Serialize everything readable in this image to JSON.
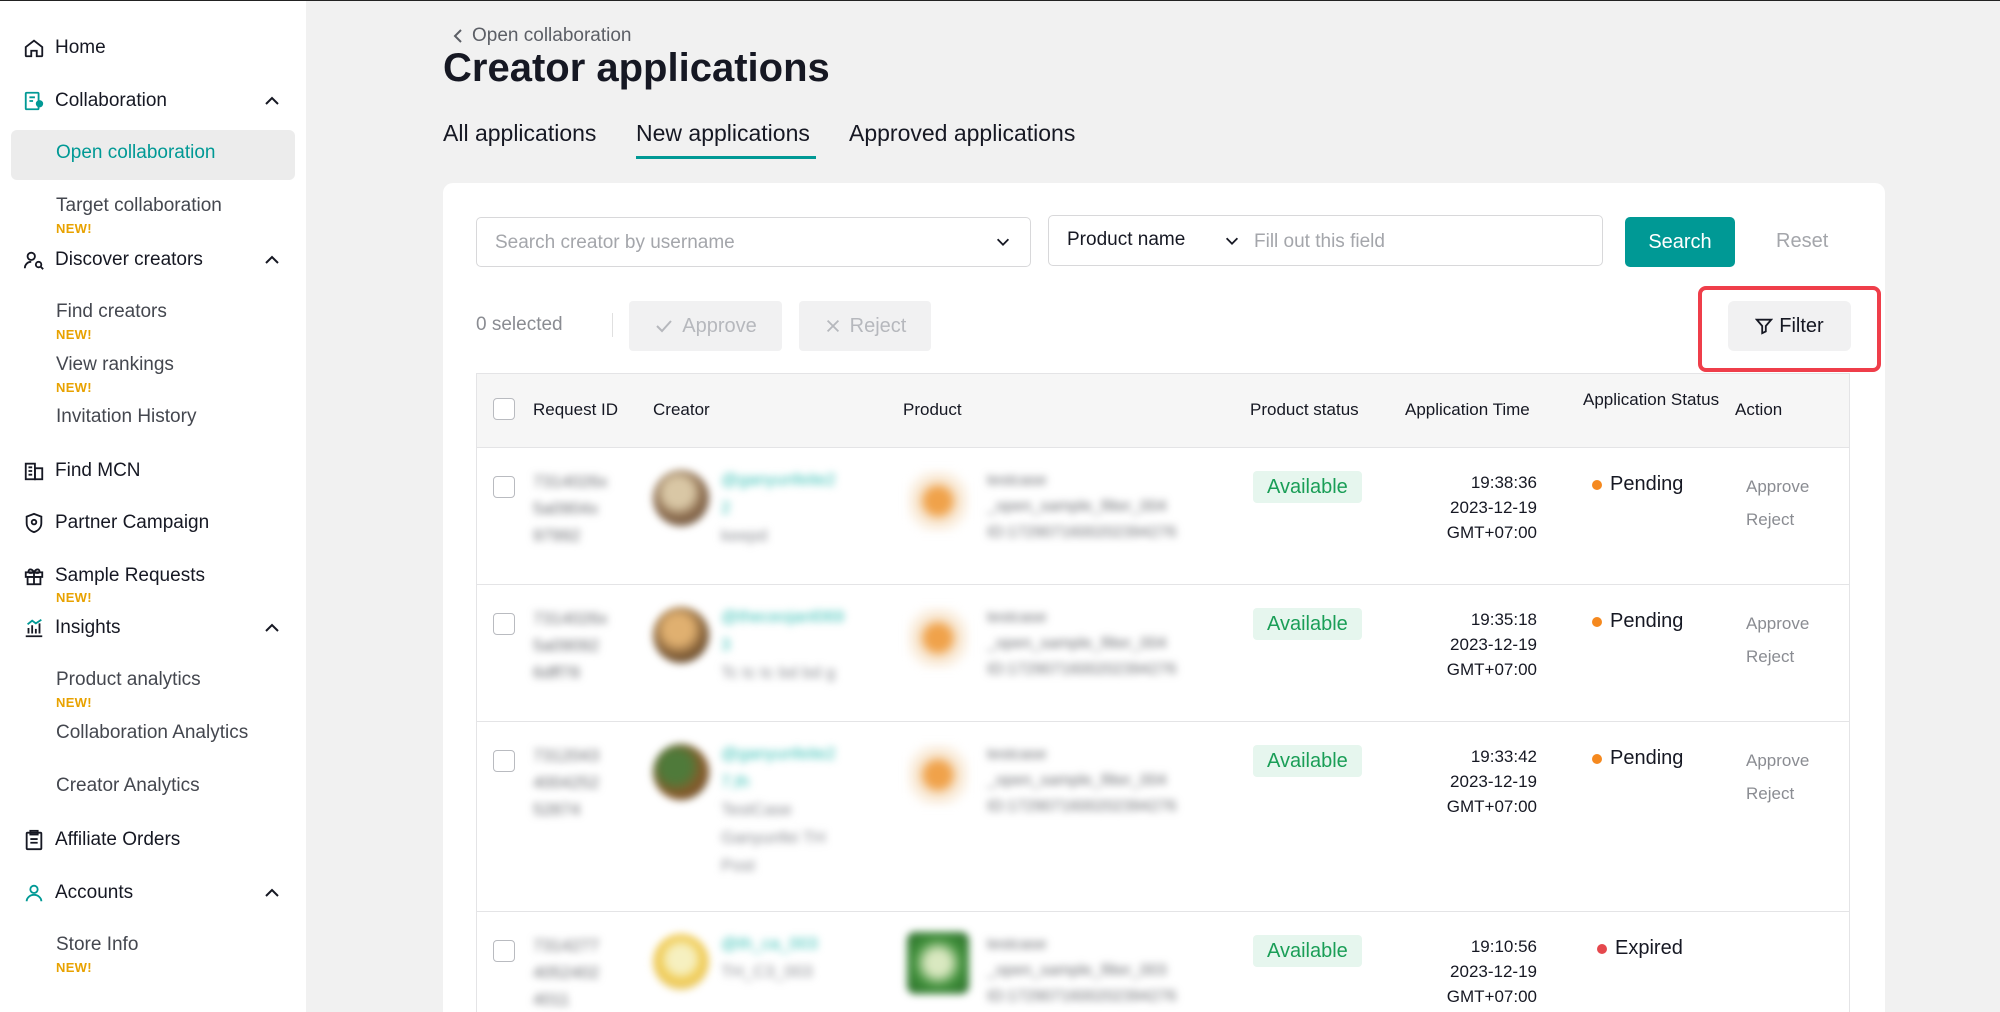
{
  "sidebar": {
    "items": [
      {
        "label": "Home",
        "icon": "home-icon"
      },
      {
        "label": "Collaboration",
        "icon": "collaboration-icon"
      },
      {
        "label": "Open collaboration"
      },
      {
        "label": "Target collaboration",
        "badge": "NEW!"
      },
      {
        "label": "Discover creators",
        "icon": "discover-creators-icon"
      },
      {
        "label": "Find creators",
        "badge": "NEW!"
      },
      {
        "label": "View rankings",
        "badge": "NEW!"
      },
      {
        "label": "Invitation History"
      },
      {
        "label": "Find MCN",
        "icon": "building-icon"
      },
      {
        "label": "Partner Campaign",
        "icon": "shield-icon"
      },
      {
        "label": "Sample Requests",
        "icon": "gift-icon",
        "badge": "NEW!"
      },
      {
        "label": "Insights",
        "icon": "bar-chart-icon"
      },
      {
        "label": "Product analytics",
        "badge": "NEW!"
      },
      {
        "label": "Collaboration Analytics"
      },
      {
        "label": "Creator Analytics"
      },
      {
        "label": "Affiliate Orders",
        "icon": "clipboard-icon"
      },
      {
        "label": "Accounts",
        "icon": "user-icon"
      },
      {
        "label": "Store Info",
        "badge": "NEW!"
      }
    ]
  },
  "header": {
    "back_label": "Open collaboration",
    "title": "Creator applications"
  },
  "tabs": [
    {
      "label": "All applications"
    },
    {
      "label": "New applications",
      "active": true
    },
    {
      "label": "Approved applications"
    }
  ],
  "search": {
    "creator_placeholder": "Search creator by username",
    "product_field_selected": "Product name",
    "product_placeholder": "Fill out this field",
    "search_label": "Search",
    "reset_label": "Reset"
  },
  "toolbar": {
    "selected_count": "0 selected",
    "approve_label": "Approve",
    "reject_label": "Reject",
    "filter_label": "Filter"
  },
  "table": {
    "columns": [
      "Request ID",
      "Creator",
      "Product",
      "Product status",
      "Application Time",
      "Application Status",
      "Action"
    ],
    "rows": [
      {
        "request_id": [
          "7314026x",
          "5a0904x",
          "97992"
        ],
        "creator_name": [
          "@ganyunfeite2",
          "2"
        ],
        "creator_sub": [
          "keepd"
        ],
        "product": [
          "testcase",
          "_open_sample_filter_004",
          "ID:1729071600202394276"
        ],
        "product_status": "Available",
        "time": [
          "19:38:36",
          "2023-12-19",
          "GMT+07:00"
        ],
        "app_status": "Pending",
        "actions": [
          "Approve",
          "Reject"
        ]
      },
      {
        "request_id": [
          "7314026x",
          "5a09092",
          "6dff78"
        ],
        "creator_name": [
          "@theceojanl069",
          "3"
        ],
        "creator_sub": [
          "Tc tc tc bd bd g"
        ],
        "product": [
          "testcase",
          "_open_sample_filter_004",
          "ID:1729071600202394276"
        ],
        "product_status": "Available",
        "time": [
          "19:35:18",
          "2023-12-19",
          "GMT+07:00"
        ],
        "app_status": "Pending",
        "actions": [
          "Approve",
          "Reject"
        ]
      },
      {
        "request_id": [
          "7312043",
          "4004252",
          "52874"
        ],
        "creator_name": [
          "@ganyunfeite2",
          "7,th"
        ],
        "creator_sub": [
          "TestCase",
          "Ganyunfei TH",
          "Post"
        ],
        "product": [
          "testcase",
          "_open_sample_filter_004",
          "ID:1729071600202394276"
        ],
        "product_status": "Available",
        "time": [
          "19:33:42",
          "2023-12-19",
          "GMT+07:00"
        ],
        "app_status": "Pending",
        "actions": [
          "Approve",
          "Reject"
        ]
      },
      {
        "request_id": [
          "7314277",
          "4052402",
          "4011"
        ],
        "creator_name": [
          "@th_ca_003"
        ],
        "creator_sub": [
          "TH_C3_003"
        ],
        "product": [
          "testcase",
          "_open_sample_filter_003",
          "ID:1729071600202394276"
        ],
        "product_status": "Available",
        "time": [
          "19:10:56",
          "2023-12-19",
          "GMT+07:00"
        ],
        "app_status": "Expired",
        "actions": []
      }
    ]
  },
  "colors": {
    "accent": "#009995",
    "pending_dot": "#f5891f",
    "expired_dot": "#e5484d",
    "highlight": "#ef3e4a",
    "badge": "#e8a200"
  }
}
